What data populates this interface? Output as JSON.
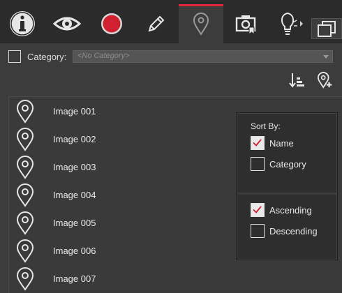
{
  "toolbar": {
    "tabs": [
      {
        "icon": "info-icon"
      },
      {
        "icon": "eye-icon"
      },
      {
        "icon": "record-icon"
      },
      {
        "icon": "pencil-icon"
      },
      {
        "icon": "location-pin-icon",
        "active": true
      },
      {
        "icon": "camera-bookmark-icon"
      },
      {
        "icon": "lightbulb-icon"
      }
    ],
    "window_button_icon": "window-restore-icon"
  },
  "category": {
    "label": "Category:",
    "checked": false,
    "selected_value": "<No Category>"
  },
  "tools": [
    "sort-list-icon",
    "add-location-pin-icon"
  ],
  "list": {
    "items": [
      {
        "label": "Image 001"
      },
      {
        "label": "Image 002"
      },
      {
        "label": "Image 003"
      },
      {
        "label": "Image 004"
      },
      {
        "label": "Image 005"
      },
      {
        "label": "Image 006"
      },
      {
        "label": "Image 007"
      }
    ]
  },
  "sort_popup": {
    "title": "Sort By:",
    "options": [
      {
        "label": "Name",
        "checked": true
      },
      {
        "label": "Category",
        "checked": false
      }
    ],
    "order": [
      {
        "label": "Ascending",
        "checked": true
      },
      {
        "label": "Descending",
        "checked": false
      }
    ]
  },
  "colors": {
    "accent": "#e3263b",
    "background": "#3c3c3c",
    "toolbar": "#2b2b2b"
  }
}
